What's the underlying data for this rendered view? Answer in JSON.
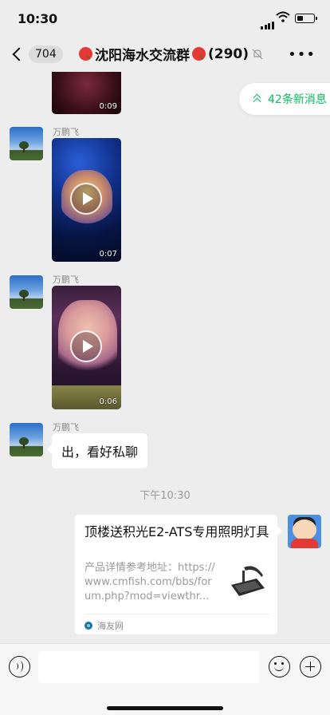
{
  "status_bar": {
    "time": "10:30"
  },
  "nav": {
    "back_count": "704",
    "title": "沈阳海水交流群",
    "member_count": "(290)",
    "more_icon": "more-horizontal-icon"
  },
  "new_messages": {
    "label": "42条新消息"
  },
  "messages": [
    {
      "type": "video",
      "duration": "0:09"
    },
    {
      "type": "video",
      "sender": "万鹏飞",
      "duration": "0:07"
    },
    {
      "type": "video",
      "sender": "万鹏飞",
      "duration": "0:06"
    },
    {
      "type": "text",
      "sender": "万鹏飞",
      "text": "出，看好私聊"
    },
    {
      "type": "timestamp",
      "text": "下午10:30"
    },
    {
      "type": "link_card",
      "title": "顶楼送积光E2-ATS专用照明灯具",
      "description": "产品详情参考地址：https://www.cmfish.com/bbs/forum.php?mod=viewthr...",
      "source": "海友网"
    }
  ],
  "input_bar": {
    "placeholder": ""
  },
  "colors": {
    "background": "#ededed",
    "accent": "#07c160",
    "bubble": "#ffffff"
  }
}
